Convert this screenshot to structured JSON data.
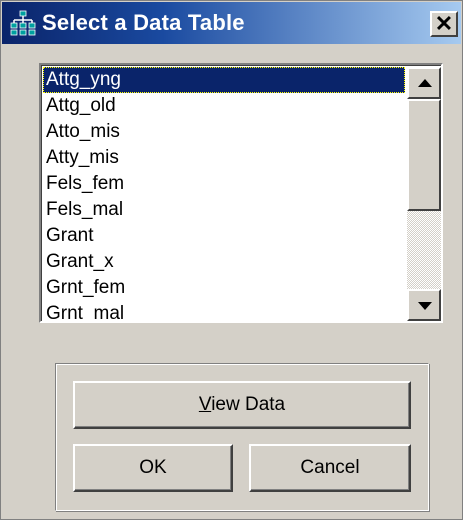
{
  "window": {
    "title": "Select a Data Table",
    "icon": "data-hierarchy-icon",
    "close_label": "✕"
  },
  "list": {
    "items": [
      {
        "label": "Attg_yng",
        "selected": true
      },
      {
        "label": "Attg_old",
        "selected": false
      },
      {
        "label": "Atto_mis",
        "selected": false
      },
      {
        "label": "Atty_mis",
        "selected": false
      },
      {
        "label": "Fels_fem",
        "selected": false
      },
      {
        "label": "Fels_mal",
        "selected": false
      },
      {
        "label": "Grant",
        "selected": false
      },
      {
        "label": "Grant_x",
        "selected": false
      },
      {
        "label": "Grnt_fem",
        "selected": false
      },
      {
        "label": "Grnt_mal",
        "selected": false
      }
    ]
  },
  "buttons": {
    "view_data_accel": "V",
    "view_data_rest": "iew Data",
    "ok": "OK",
    "cancel": "Cancel"
  },
  "colors": {
    "title_bar_start": "#0a246a",
    "title_bar_end": "#a6caf0",
    "selection": "#0a246a",
    "dialog_face": "#d4d0c8"
  }
}
